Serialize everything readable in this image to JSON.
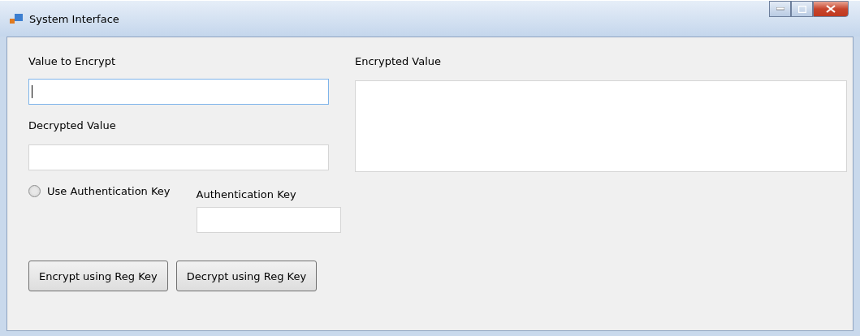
{
  "window": {
    "title": "System Interface"
  },
  "value_to_encrypt": {
    "label": "Value to Encrypt",
    "focused": true
  },
  "decrypted_value": {
    "label": "Decrypted Value"
  },
  "use_authentication_key": {
    "label": "Use Authentication Key",
    "selected": false
  },
  "authentication_key": {
    "label": "Authentication Key"
  },
  "encrypted_value": {
    "label": "Encrypted Value"
  },
  "buttons": [
    "Encrypt using Reg Key",
    "Decrypt using Reg Key"
  ]
}
